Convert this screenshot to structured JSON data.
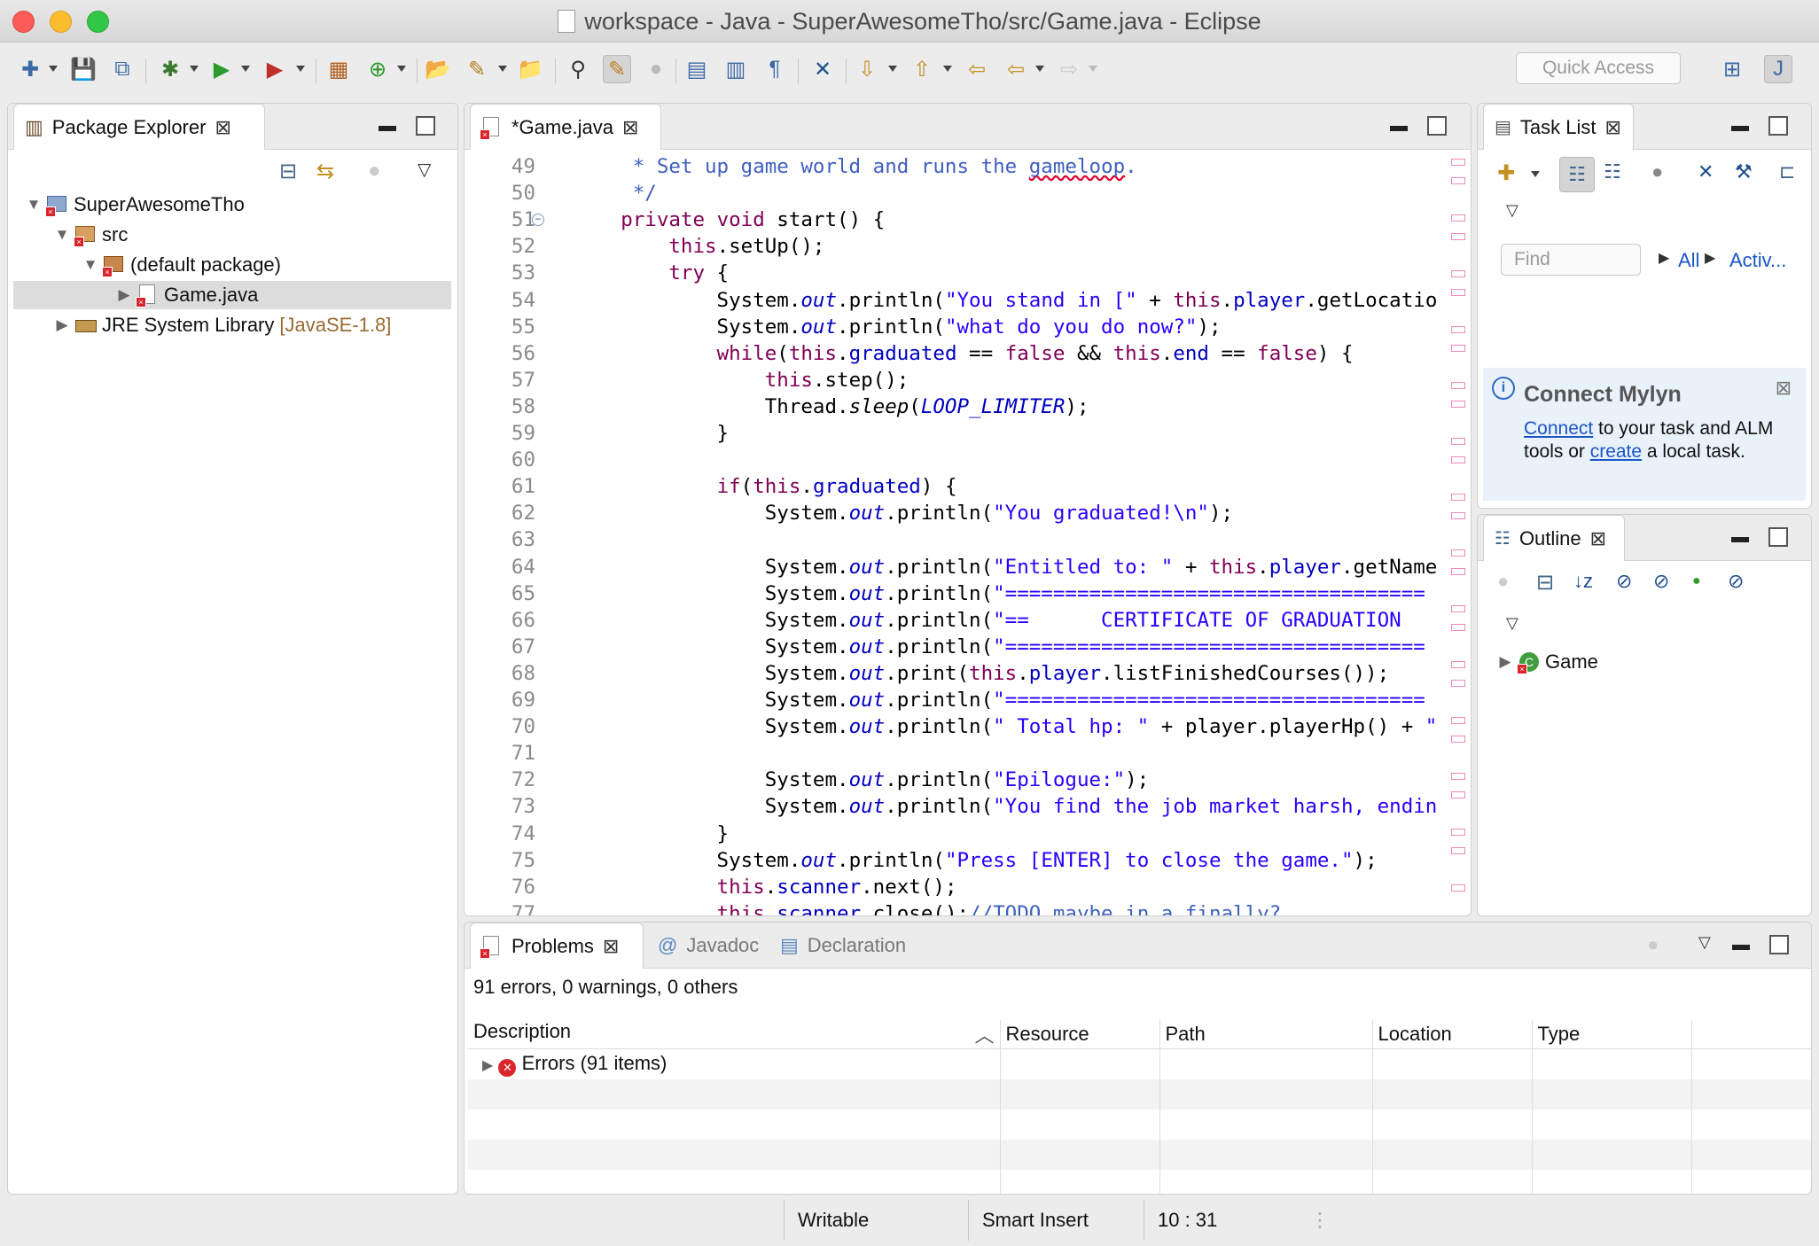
{
  "window": {
    "title": "workspace - Java - SuperAwesomeTho/src/Game.java - Eclipse",
    "traffic_lights": {
      "close": "#fc5c57",
      "minimize": "#fdbc2e",
      "zoom": "#33c748"
    }
  },
  "toolbar": {
    "quick_access_placeholder": "Quick Access"
  },
  "package_explorer": {
    "tab_label": "Package Explorer",
    "tree": [
      {
        "label": "SuperAwesomeTho",
        "icon": "project-icon",
        "expanded": true
      },
      {
        "label": "src",
        "icon": "package-folder-icon",
        "expanded": true
      },
      {
        "label": "(default package)",
        "icon": "package-icon",
        "expanded": true
      },
      {
        "label": "Game.java",
        "icon": "java-file-icon",
        "selected": true
      },
      {
        "label": "JRE System Library",
        "suffix": "[JavaSE-1.8]",
        "icon": "library-icon"
      }
    ]
  },
  "editor": {
    "tab_label": "*Game.java",
    "lines": [
      {
        "n": "49",
        "text": "     * Set up game world and runs the gameloop."
      },
      {
        "n": "50",
        "text": "     */"
      },
      {
        "n": "51",
        "text": "    private void start() {"
      },
      {
        "n": "52",
        "text": "        this.setUp();"
      },
      {
        "n": "53",
        "text": "        try {"
      },
      {
        "n": "54",
        "text": "            System.out.println(\"You stand in [\" + this.player.getLocatio"
      },
      {
        "n": "55",
        "text": "            System.out.println(\"what do you do now?\");"
      },
      {
        "n": "56",
        "text": "            while(this.graduated == false && this.end == false) {"
      },
      {
        "n": "57",
        "text": "                this.step();"
      },
      {
        "n": "58",
        "text": "                Thread.sleep(LOOP_LIMITER);"
      },
      {
        "n": "59",
        "text": "            }"
      },
      {
        "n": "60",
        "text": ""
      },
      {
        "n": "61",
        "text": "            if(this.graduated) {"
      },
      {
        "n": "62",
        "text": "                System.out.println(\"You graduated!\\n\");"
      },
      {
        "n": "63",
        "text": ""
      },
      {
        "n": "64",
        "text": "                System.out.println(\"Entitled to: \" + this.player.getName"
      },
      {
        "n": "65",
        "text": "                System.out.println(\"==================================="
      },
      {
        "n": "66",
        "text": "                System.out.println(\"==      CERTIFICATE OF GRADUATION"
      },
      {
        "n": "67",
        "text": "                System.out.println(\"==================================="
      },
      {
        "n": "68",
        "text": "                System.out.print(this.player.listFinishedCourses());"
      },
      {
        "n": "69",
        "text": "                System.out.println(\"==================================="
      },
      {
        "n": "70",
        "text": "                System.out.println(\" Total hp: \" + player.playerHp() + \""
      },
      {
        "n": "71",
        "text": ""
      },
      {
        "n": "72",
        "text": "                System.out.println(\"Epilogue:\");"
      },
      {
        "n": "73",
        "text": "                System.out.println(\"You find the job market harsh, endin"
      },
      {
        "n": "74",
        "text": "            }"
      },
      {
        "n": "75",
        "text": "            System.out.println(\"Press [ENTER] to close the game.\");"
      },
      {
        "n": "76",
        "text": "            this.scanner.next();"
      },
      {
        "n": "77",
        "text": "            this.scanner.close();//TODO maybe in a finally?"
      }
    ]
  },
  "task_list": {
    "tab_label": "Task List",
    "find_placeholder": "Find",
    "filter_all": "All",
    "filter_active": "Activ...",
    "mylyn": {
      "title": "Connect Mylyn",
      "link_connect": "Connect",
      "text_1": " to your task and ALM tools or ",
      "link_create": "create",
      "text_2": " a local task."
    }
  },
  "outline": {
    "tab_label": "Outline",
    "root": "Game"
  },
  "bottom": {
    "tabs": [
      "Problems",
      "Javadoc",
      "Declaration"
    ],
    "summary": "91 errors, 0 warnings, 0 others",
    "columns": [
      "Description",
      "Resource",
      "Path",
      "Location",
      "Type"
    ],
    "rows": [
      {
        "description": "Errors (91 items)"
      }
    ]
  },
  "status_bar": {
    "writable": "Writable",
    "insert_mode": "Smart Insert",
    "position": "10 : 31"
  }
}
